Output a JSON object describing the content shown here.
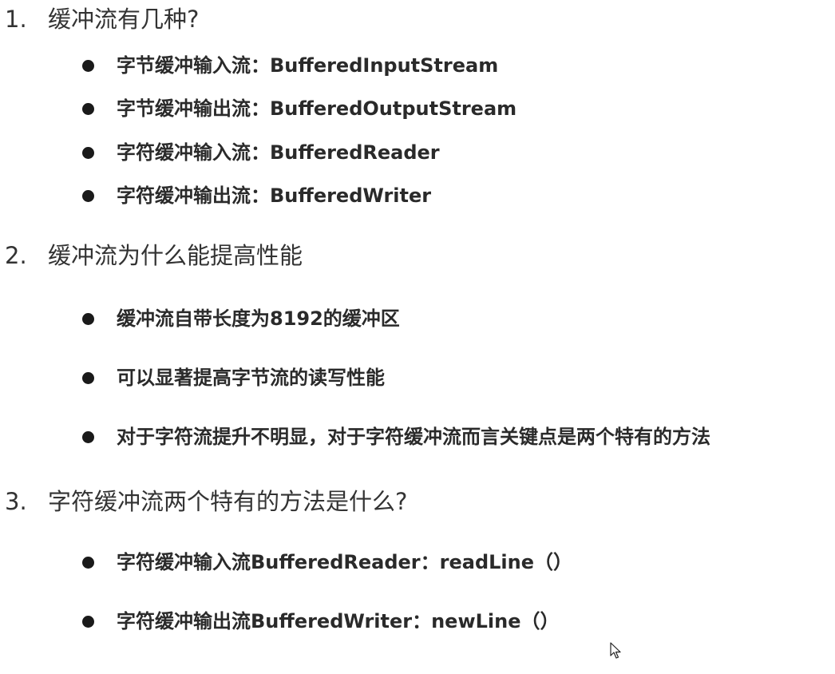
{
  "sections": [
    {
      "number": "1.",
      "title": "缓冲流有几种?",
      "items": [
        "字节缓冲输入流：BufferedInputStream",
        "字节缓冲输出流：BufferedOutputStream",
        "字符缓冲输入流：BufferedReader",
        "字符缓冲输出流：BufferedWriter"
      ]
    },
    {
      "number": "2.",
      "title": "缓冲流为什么能提高性能",
      "items": [
        "缓冲流自带长度为8192的缓冲区",
        "可以显著提高字节流的读写性能",
        "对于字符流提升不明显，对于字符缓冲流而言关键点是两个特有的方法"
      ]
    },
    {
      "number": "3.",
      "title": "字符缓冲流两个特有的方法是什么?",
      "items": [
        "字符缓冲输入流BufferedReader：readLine（）",
        "字符缓冲输出流BufferedWriter：newLine（）"
      ]
    }
  ],
  "icons": {
    "bullet": "bullet-dot-icon",
    "cursor": "mouse-pointer-icon"
  }
}
